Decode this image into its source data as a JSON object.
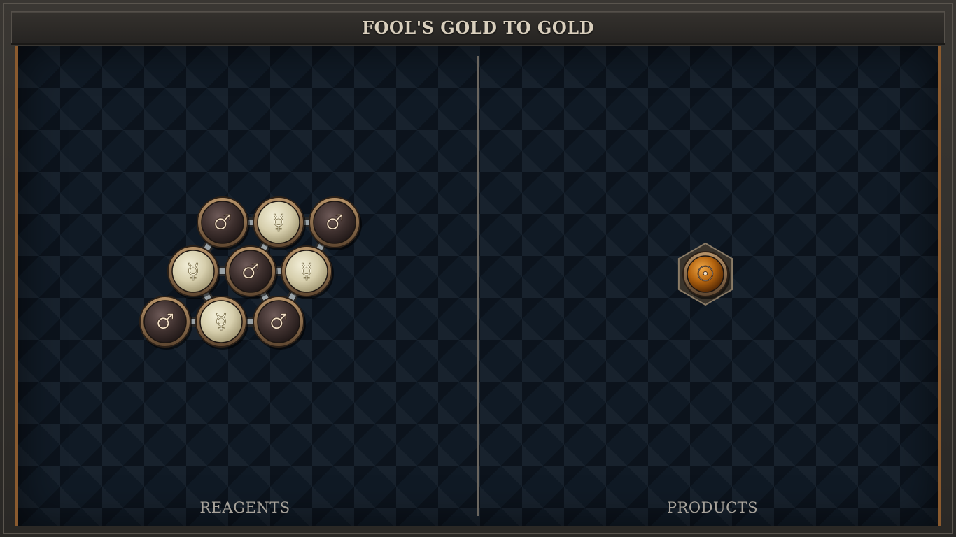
{
  "title": "FOOL'S GOLD TO GOLD",
  "reagents_label": "REAGENTS",
  "products_label": "PRODUCTS",
  "reagent_atoms": [
    {
      "element": "iron",
      "symbol": "♂"
    },
    {
      "element": "quicksilver",
      "symbol": "☿"
    },
    {
      "element": "iron",
      "symbol": "♂"
    },
    {
      "element": "quicksilver",
      "symbol": "☿"
    },
    {
      "element": "iron",
      "symbol": "♂"
    },
    {
      "element": "quicksilver",
      "symbol": "☿"
    },
    {
      "element": "iron",
      "symbol": "♂"
    },
    {
      "element": "quicksilver",
      "symbol": "☿"
    },
    {
      "element": "iron",
      "symbol": "♂"
    }
  ],
  "product_atoms": [
    {
      "element": "gold",
      "symbol": "☉"
    }
  ],
  "colors": {
    "iron": "#4a3a38",
    "quicksilver": "#d8d2b4",
    "gold": "#b86a14",
    "bronze_ring": "#8a6a4a",
    "board": "#101a25"
  }
}
